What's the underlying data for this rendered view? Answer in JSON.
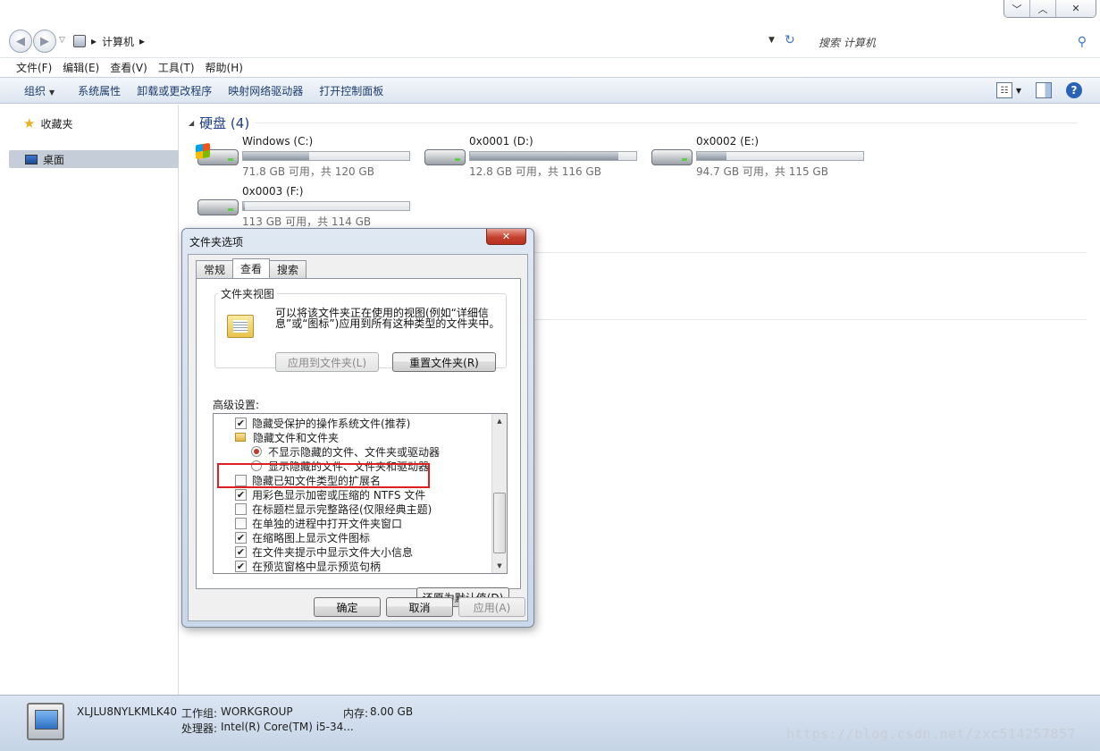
{
  "window": {
    "controls": [
      "﹀",
      "︿",
      "✕"
    ]
  },
  "address": {
    "path": "计算机",
    "search_placeholder": "搜索 计算机"
  },
  "menu": [
    "文件(F)",
    "编辑(E)",
    "查看(V)",
    "工具(T)",
    "帮助(H)"
  ],
  "toolbar": {
    "organize": "组织",
    "items": [
      "系统属性",
      "卸载或更改程序",
      "映射网络驱动器",
      "打开控制面板"
    ]
  },
  "nav": {
    "favorites": "收藏夹",
    "desktop": "桌面"
  },
  "main": {
    "group_title": "硬盘 (4)",
    "drives": [
      {
        "name": "Windows (C:)",
        "info": "71.8 GB 可用，共 120 GB",
        "used_fraction": 0.4,
        "system": true
      },
      {
        "name": "0x0001 (D:)",
        "info": "12.8 GB 可用，共 116 GB",
        "used_fraction": 0.89,
        "system": false
      },
      {
        "name": "0x0002 (E:)",
        "info": "94.7 GB 可用，共 115 GB",
        "used_fraction": 0.18,
        "system": false
      },
      {
        "name": "0x0003 (F:)",
        "info": "113 GB 可用，共 114 GB",
        "used_fraction": 0.01,
        "system": false
      }
    ]
  },
  "status": {
    "computer_name": "XLJLU8NYLKMLK40",
    "workgroup_label": "工作组:",
    "workgroup": "WORKGROUP",
    "memory_label": "内存:",
    "memory": "8.00 GB",
    "cpu_label": "处理器:",
    "cpu": "Intel(R) Core(TM) i5-34...",
    "watermark": "https://blog.csdn.net/zxc514257857"
  },
  "dialog": {
    "title": "文件夹选项",
    "close": "✕",
    "tabs": [
      "常规",
      "查看",
      "搜索"
    ],
    "active_tab": 1,
    "folder_view": {
      "title": "文件夹视图",
      "description": "可以将该文件夹正在使用的视图(例如“详细信息”或“图标”)应用到所有这种类型的文件夹中。",
      "apply_button": "应用到文件夹(L)",
      "reset_button": "重置文件夹(R)"
    },
    "advanced_label": "高级设置:",
    "settings": [
      {
        "kind": "checkbox",
        "checked": true,
        "indent": 0,
        "label": "隐藏受保护的操作系统文件(推荐)"
      },
      {
        "kind": "folder",
        "indent": 0,
        "label": "隐藏文件和文件夹"
      },
      {
        "kind": "radio",
        "checked": true,
        "indent": 1,
        "label": "不显示隐藏的文件、文件夹或驱动器"
      },
      {
        "kind": "radio",
        "checked": false,
        "indent": 1,
        "label": "显示隐藏的文件、文件夹和驱动器"
      },
      {
        "kind": "checkbox",
        "checked": false,
        "indent": 0,
        "label": "隐藏已知文件类型的扩展名"
      },
      {
        "kind": "checkbox",
        "checked": true,
        "indent": 0,
        "label": "用彩色显示加密或压缩的 NTFS 文件"
      },
      {
        "kind": "checkbox",
        "checked": false,
        "indent": 0,
        "label": "在标题栏显示完整路径(仅限经典主题)"
      },
      {
        "kind": "checkbox",
        "checked": false,
        "indent": 0,
        "label": "在单独的进程中打开文件夹窗口"
      },
      {
        "kind": "checkbox",
        "checked": true,
        "indent": 0,
        "label": "在缩略图上显示文件图标"
      },
      {
        "kind": "checkbox",
        "checked": true,
        "indent": 0,
        "label": "在文件夹提示中显示文件大小信息"
      },
      {
        "kind": "checkbox",
        "checked": true,
        "indent": 0,
        "label": "在预览窗格中显示预览句柄"
      }
    ],
    "restore_button": "还原为默认值(D)",
    "ok": "确定",
    "cancel": "取消",
    "apply": "应用(A)"
  }
}
